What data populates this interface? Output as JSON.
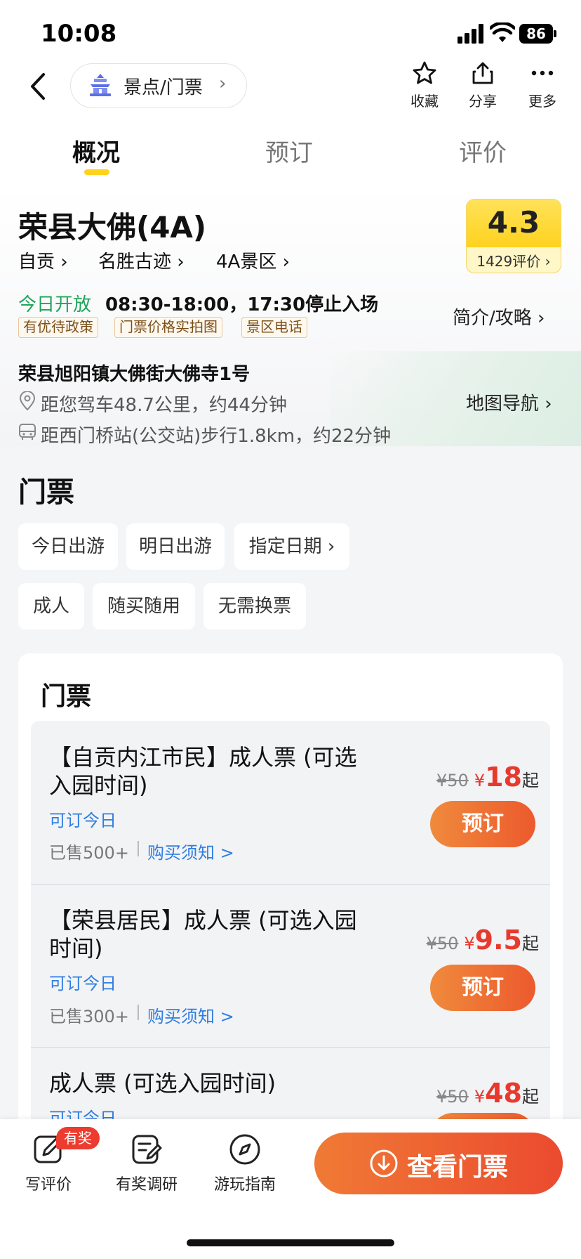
{
  "status_bar": {
    "time": "10:08",
    "battery": "86"
  },
  "nav": {
    "breadcrumb": "景点/门票",
    "actions": [
      {
        "label": "收藏",
        "icon": "star-icon"
      },
      {
        "label": "分享",
        "icon": "share-icon"
      },
      {
        "label": "更多",
        "icon": "more-icon"
      }
    ]
  },
  "tabs": [
    {
      "label": "概况",
      "active": true
    },
    {
      "label": "预订",
      "active": false
    },
    {
      "label": "评价",
      "active": false
    }
  ],
  "attraction": {
    "title": "荣县大佛(4A)",
    "categories": [
      "自贡",
      "名胜古迹",
      "4A景区"
    ],
    "rating": "4.3",
    "review_count": "1429评价",
    "open_status": "今日开放",
    "open_hours": "08:30-18:00，17:30停止入场",
    "tags": [
      "有优待政策",
      "门票价格实拍图",
      "景区电话"
    ],
    "intro_link": "简介/攻略",
    "address": "荣县旭阳镇大佛街大佛寺1号",
    "drive_distance": "距您驾车48.7公里，约44分钟",
    "bus_distance": "距西门桥站(公交站)步行1.8km，约22分钟",
    "map_link": "地图导航"
  },
  "tickets_section": {
    "title": "门票",
    "date_filters": [
      "今日出游",
      "明日出游",
      "指定日期"
    ],
    "feature_filters": [
      "成人",
      "随买随用",
      "无需换票"
    ],
    "card_title": "门票",
    "currency": "¥",
    "from_label": "起",
    "book_label": "预订",
    "notice_label": "购买须知 >",
    "items": [
      {
        "name": "【自贡内江市民】成人票 (可选入园时间)",
        "availability": "可订今日",
        "sold": "已售500+",
        "original_price": "¥50",
        "price": "18"
      },
      {
        "name": "【荣县居民】成人票 (可选入园时间)",
        "availability": "可订今日",
        "sold": "已售300+",
        "original_price": "¥50",
        "price": "9.5"
      },
      {
        "name": "成人票 (可选入园时间)",
        "availability": "可订今日",
        "sold": "",
        "original_price": "¥50",
        "price": "48"
      }
    ]
  },
  "bottom_bar": {
    "items": [
      {
        "label": "写评价",
        "icon": "edit-icon"
      },
      {
        "label": "有奖调研",
        "icon": "survey-icon"
      },
      {
        "label": "游玩指南",
        "icon": "compass-icon"
      }
    ],
    "badge": "有奖",
    "main_button": "查看门票"
  },
  "colors": {
    "accent_orange": "#EC5A2D",
    "price_red": "#E8392D",
    "open_green": "#1FA55A",
    "link_blue": "#2F7DE1",
    "rating_yellow": "#FFD21E"
  }
}
